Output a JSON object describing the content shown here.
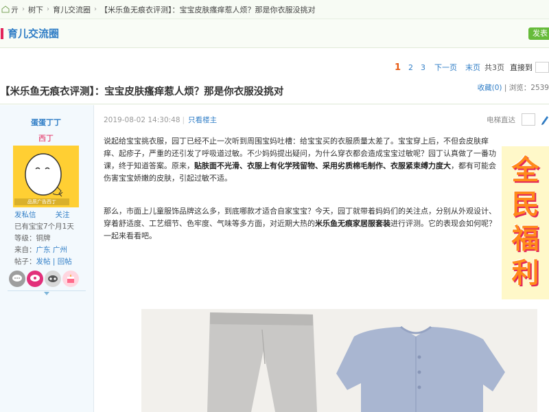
{
  "breadcrumb": {
    "home": "亓",
    "items": [
      "树下",
      "育儿交流圈",
      "【米乐鱼无痕衣评测】：宝宝皮肤瘙痒惹人烦？那是你衣服没挑对"
    ]
  },
  "forum": {
    "title": "育儿交流圈",
    "side_button": "发表"
  },
  "pagination": {
    "current": "1",
    "pages": [
      "2",
      "3"
    ],
    "next": "下一页",
    "last": "末页",
    "total": "共3页",
    "jump": "直接到"
  },
  "thread": {
    "title": "【米乐鱼无痕衣评测】：宝宝皮肤瘙痒惹人烦？那是你衣服没挑对",
    "fav": "收藏(0)",
    "views": "浏览：2539"
  },
  "user": {
    "name": "蛋蛋丁丁",
    "rank": "西丁",
    "avatar_caption": "品质广告西丁",
    "follow": [
      "发私信",
      "关注"
    ],
    "baby": "已有宝宝7个月1天",
    "level_label": "等级：",
    "level": "铜牌",
    "from_label": "来自：",
    "from": "广东 广州",
    "posts_label": "帖子：",
    "posts": "发帖 | 回帖"
  },
  "post": {
    "time": "2019-08-02 14:30:48",
    "only_op": "只看楼主",
    "floor_jump": "电梯直达",
    "p1": "说起给宝宝挑衣服，园丁已经不止一次听到周围宝妈吐槽：给宝宝买的衣服质量太差了。宝宝穿上后，不但会皮肤痒痒、起疹子，严重的还引发了呼吸道过敏。不少妈妈提出疑问，为什么穿衣都会造成宝宝过敏呢？园丁认真做了一番功课，终于知道答案。原来，",
    "p1_bold": "贴肤面不光滑、衣服上有化学残留物、采用劣质棉毛制作、衣服紧束缚力度大",
    "p1_end": "，都有可能会伤害宝宝娇嫩的皮肤，引起过敏不适。",
    "p2": "那么，市面上儿童服饰品牌这么多，到底哪款才适合自家宝宝？今天，园丁就带着妈妈们的关注点，分别从外观设计、穿着舒适度、工艺细节、色牢度、气味等多方面，对近期大热的",
    "p2_bold": "米乐鱼无痕家居服套装",
    "p2_end": "进行评测。它的表现会如何呢？一起来看看吧。"
  },
  "promo": {
    "chars": [
      "全",
      "民",
      "福",
      "利"
    ]
  },
  "colors": {
    "link": "#2f7dc6",
    "accent": "#e2245a",
    "current_page": "#e75a13",
    "green": "#66bb3a"
  }
}
